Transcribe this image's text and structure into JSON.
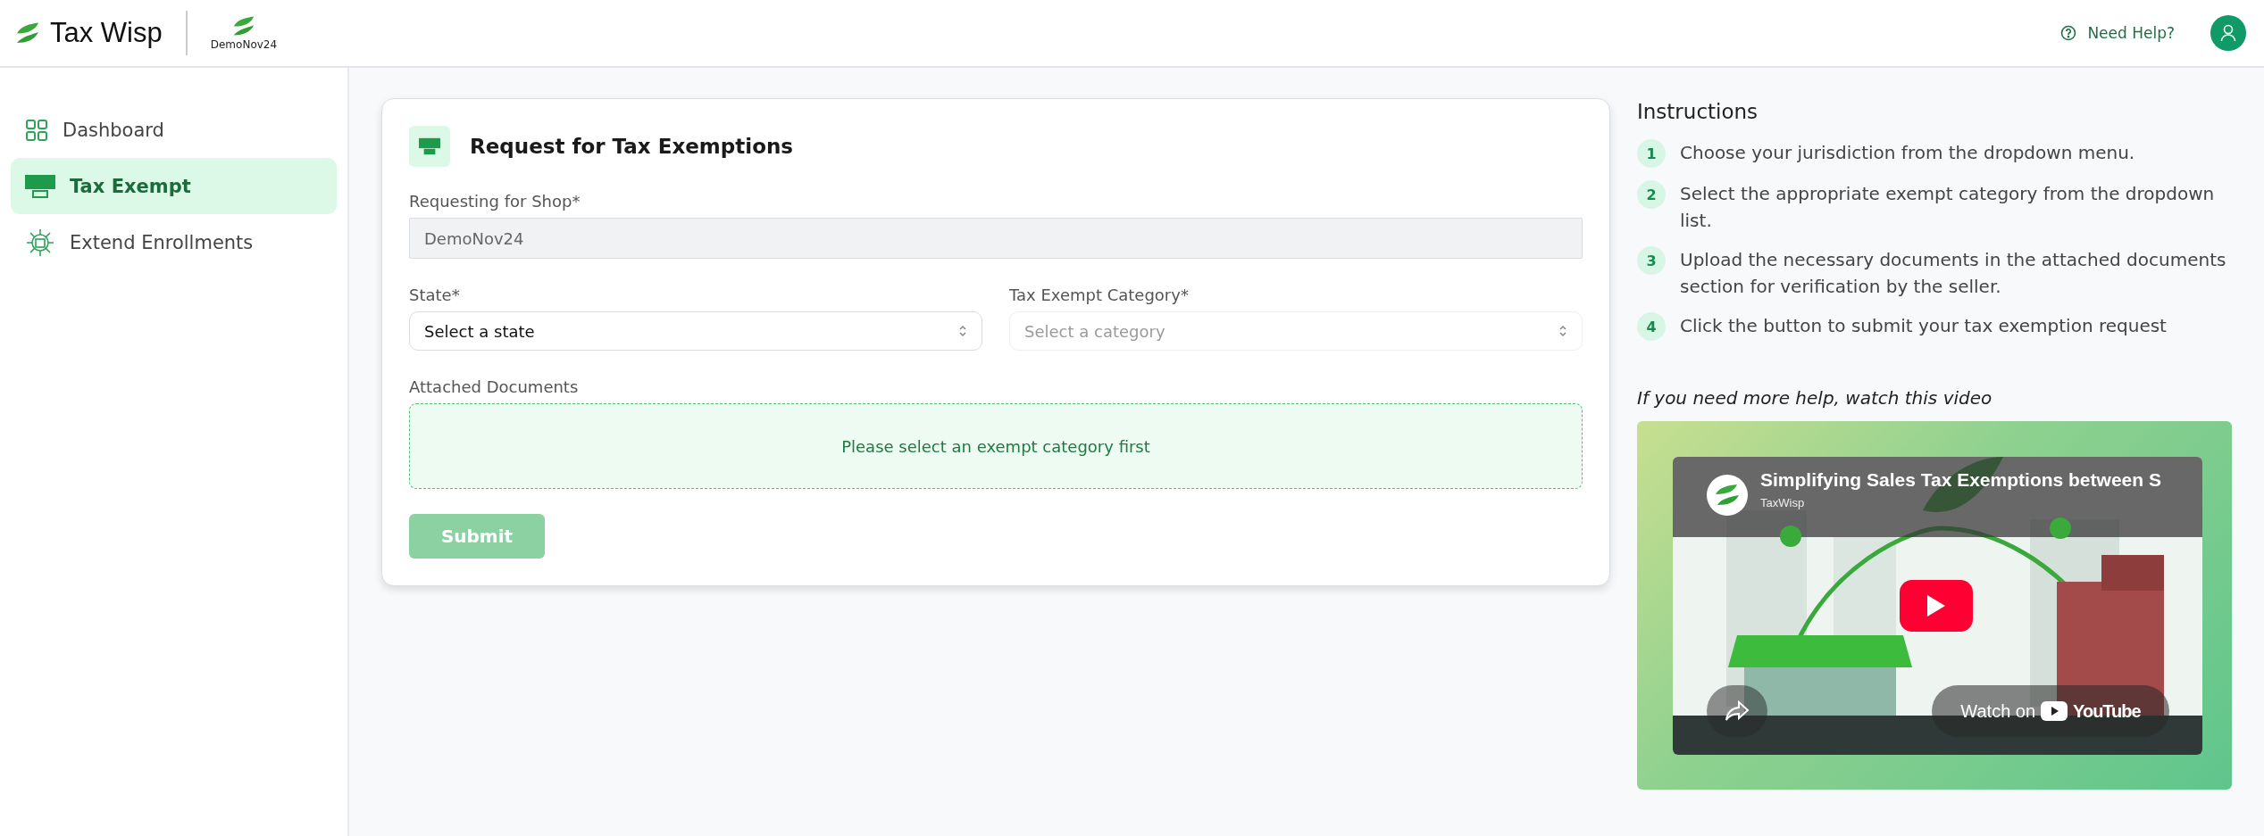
{
  "header": {
    "brand": "Tax Wisp",
    "shop_name": "DemoNov24",
    "help_link": "Need Help?"
  },
  "sidebar": {
    "items": [
      {
        "label": "Dashboard",
        "selected": false
      },
      {
        "label": "Tax Exempt",
        "selected": true
      },
      {
        "label": "Extend Enrollments",
        "selected": false
      }
    ]
  },
  "form": {
    "title": "Request for Tax Exemptions",
    "fields": [
      {
        "kind": "text",
        "label": "Requesting for Shop*",
        "value": "DemoNov24",
        "disabled": true
      },
      {
        "kind": "select",
        "label": "State*",
        "placeholder": "Select a state",
        "disabled": false
      },
      {
        "kind": "select",
        "label": "Tax Exempt Category*",
        "placeholder": "Select a category",
        "disabled": true
      }
    ],
    "documents": {
      "label": "Attached Documents",
      "message": "Please select an exempt category first"
    },
    "submit": {
      "label": "Submit",
      "disabled": true
    }
  },
  "instructions": {
    "title": "Instructions",
    "steps": [
      {
        "number": "1",
        "text": "Choose your jurisdiction from the dropdown menu."
      },
      {
        "number": "2",
        "text": "Select the appropriate exempt category from the dropdown list."
      },
      {
        "number": "3",
        "text": "Upload the necessary documents in the attached documents section for verification by the seller."
      },
      {
        "number": "4",
        "text": "Click the button to submit your tax exemption request"
      }
    ],
    "video_prompt": "If you need more help, watch this video",
    "video": {
      "title": "Simplifying Sales Tax Exemptions between S",
      "channel": "TaxWisp",
      "watch_label": "Watch on",
      "platform": "YouTube"
    }
  }
}
